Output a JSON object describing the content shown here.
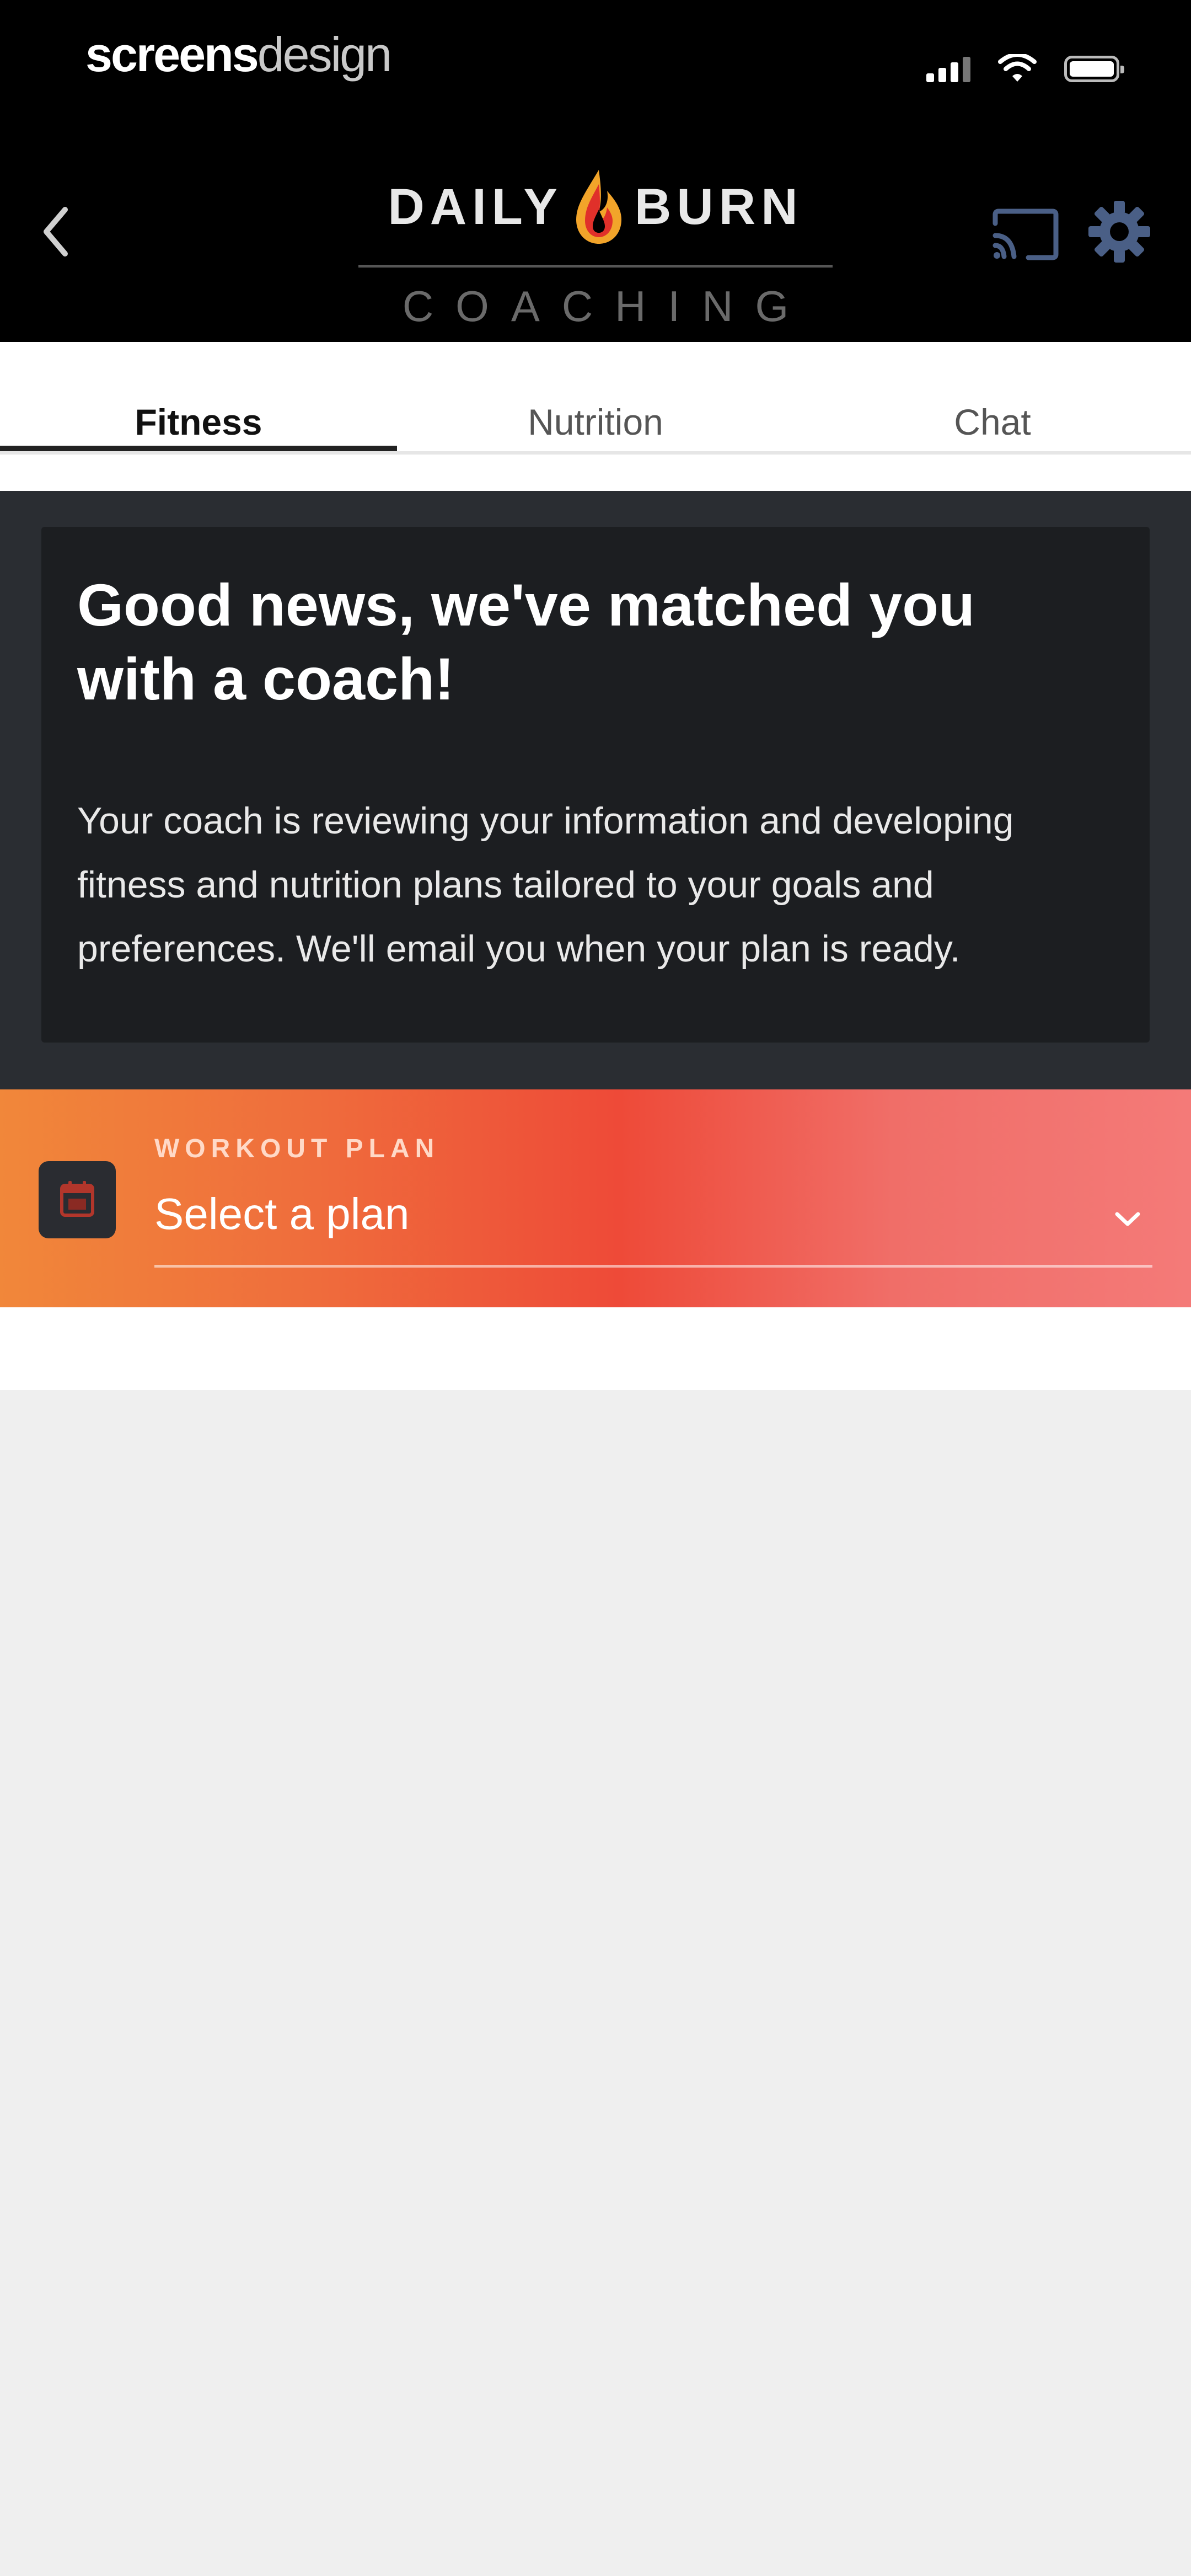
{
  "status_bar": {
    "carrier_bold": "screens",
    "carrier_light": "design"
  },
  "header": {
    "logo": {
      "word_left": "DAILY",
      "word_right": "BURN",
      "subtitle": "COACHING",
      "flame_colors": [
        "#f2a42a",
        "#e0302a"
      ]
    },
    "icons": {
      "back": "chevron-left-icon",
      "cast": "cast-icon",
      "settings": "gear-icon"
    }
  },
  "tabs": [
    {
      "label": "Fitness",
      "active": true
    },
    {
      "label": "Nutrition",
      "active": false
    },
    {
      "label": "Chat",
      "active": false
    }
  ],
  "card": {
    "title": "Good news, we've matched you with a coach!",
    "body": "Your coach is reviewing your information and developing fitness and nutrition plans tailored to your goals and preferences. We'll email you when your plan is ready."
  },
  "workout_plan": {
    "label": "WORKOUT PLAN",
    "placeholder": "Select a plan",
    "icon": "calendar-icon",
    "gradient": [
      "#f1873a",
      "#ee4a38",
      "#f47a78"
    ]
  },
  "colors": {
    "header_bg": "#000000",
    "dark_section_bg": "#2a2d32",
    "card_bg": "#1c1e21",
    "page_bg": "#efefef"
  }
}
